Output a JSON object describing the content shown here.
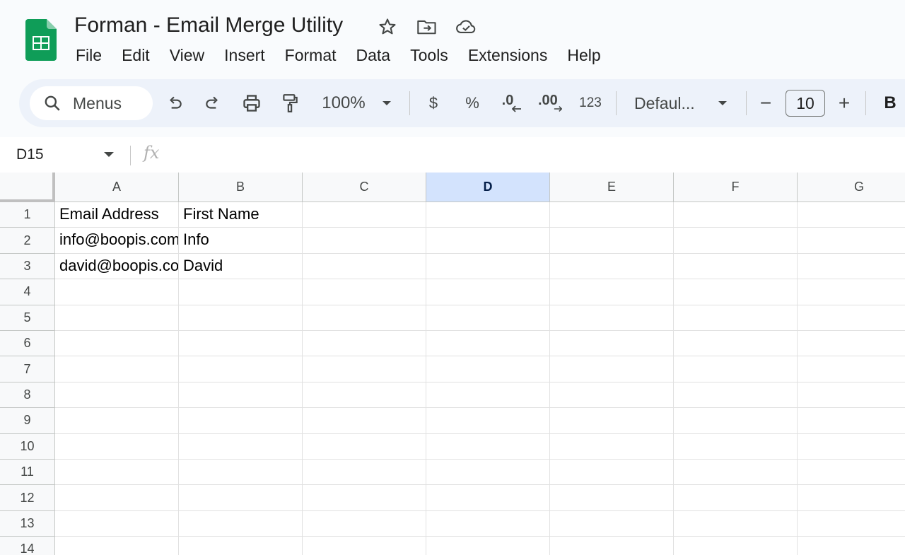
{
  "document": {
    "title": "Forman - Email Merge Utility"
  },
  "title_icons": [
    "star-icon",
    "move-to-folder-icon",
    "cloud-saved-icon"
  ],
  "menubar": [
    "File",
    "Edit",
    "View",
    "Insert",
    "Format",
    "Data",
    "Tools",
    "Extensions",
    "Help"
  ],
  "toolbar": {
    "search_label": "Menus",
    "zoom": "100%",
    "currency": "$",
    "percent": "%",
    "decrease_decimal": ".0",
    "increase_decimal": ".00",
    "number_format": "123",
    "font": "Defaul...",
    "font_size": "10",
    "minus": "−",
    "plus": "+",
    "bold": "B"
  },
  "formula_bar": {
    "name_box": "D15",
    "fx": "fx",
    "value": ""
  },
  "grid": {
    "columns": [
      "A",
      "B",
      "C",
      "D",
      "E",
      "F",
      "G"
    ],
    "selected_column": "D",
    "row_numbers": [
      "1",
      "2",
      "3",
      "4",
      "5",
      "6",
      "7",
      "8",
      "9",
      "10",
      "11",
      "12",
      "13",
      "14"
    ],
    "rows": [
      [
        "Email Address",
        "First Name",
        "",
        "",
        "",
        "",
        ""
      ],
      [
        "info@boopis.com",
        "Info",
        "",
        "",
        "",
        "",
        ""
      ],
      [
        "david@boopis.com",
        "David",
        "",
        "",
        "",
        "",
        ""
      ]
    ]
  },
  "colors": {
    "accent": "#0b57d0",
    "selected_header": "#d3e3fd",
    "toolbar_bg": "#edf2fa",
    "sheets_green": "#0f9d58"
  }
}
